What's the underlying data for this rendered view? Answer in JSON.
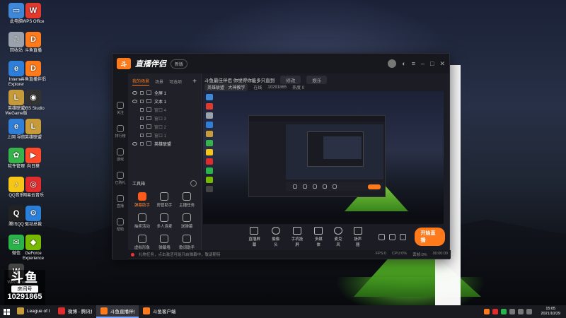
{
  "desktop": {
    "icons": [
      {
        "label": "此电脑",
        "color": "#3f87d9",
        "glyph": "▭"
      },
      {
        "label": "WPS Office",
        "color": "#e03a2f",
        "glyph": "W"
      },
      {
        "label": "回收站",
        "color": "#9aa3ad",
        "glyph": "♲"
      },
      {
        "label": "斗鱼直播",
        "color": "#ff7a1a",
        "glyph": "D"
      },
      {
        "label": "Internet Explorer",
        "color": "#2f7fd8",
        "glyph": "e"
      },
      {
        "label": "斗鱼直播伴侣",
        "color": "#ff7a1a",
        "glyph": "D"
      },
      {
        "label": "英雄联盟 WeGame版",
        "color": "#c79a3a",
        "glyph": "L"
      },
      {
        "label": "OBS Studio",
        "color": "#333333",
        "glyph": "◉"
      },
      {
        "label": "上网 导航",
        "color": "#2f7fd8",
        "glyph": "e"
      },
      {
        "label": "英雄联盟",
        "color": "#c79a3a",
        "glyph": "L"
      },
      {
        "label": "软件管理",
        "color": "#36b34a",
        "glyph": "✿"
      },
      {
        "label": "向日葵",
        "color": "#ff4a2a",
        "glyph": "▶"
      },
      {
        "label": "QQ音乐",
        "color": "#f5c518",
        "glyph": "♪"
      },
      {
        "label": "网易云音乐",
        "color": "#e02c2c",
        "glyph": "◎"
      },
      {
        "label": "腾讯QQ",
        "color": "#222222",
        "glyph": "Q"
      },
      {
        "label": "驱动总裁",
        "color": "#2a7fd8",
        "glyph": "⚙"
      },
      {
        "label": "微信",
        "color": "#2ab34a",
        "glyph": "✉"
      },
      {
        "label": "GeForce Experience",
        "color": "#76b900",
        "glyph": "◆"
      },
      {
        "label": "WeGame",
        "color": "#444444",
        "glyph": "W"
      }
    ],
    "douyu_block": {
      "logo": "斗鱼",
      "room_label": "房间号",
      "room_number": "10291865"
    }
  },
  "app": {
    "name": "直播伴侣",
    "version_pill": "新版",
    "title_controls": [
      "皮肤",
      "菜单",
      "最小化",
      "最大化",
      "关闭"
    ],
    "rail": [
      {
        "label": "关注"
      },
      {
        "label": "排行榜"
      },
      {
        "label": "游戏"
      },
      {
        "label": "已购礼"
      },
      {
        "label": "直播"
      },
      {
        "label": "帮助"
      }
    ],
    "scene_tabs": [
      "我的场景",
      "场景",
      "可选项"
    ],
    "layers": [
      {
        "label": "全屏 1",
        "dim": false
      },
      {
        "label": "文本 1",
        "dim": false
      },
      {
        "label": "窗口 4",
        "dim": true
      },
      {
        "label": "窗口 3",
        "dim": true
      },
      {
        "label": "窗口 2",
        "dim": true
      },
      {
        "label": "窗口 1",
        "dim": true
      },
      {
        "label": "英雄联盟",
        "dim": false
      }
    ],
    "toolbox_title": "工具箱",
    "tools": [
      {
        "label": "弹幕助手",
        "hot": true
      },
      {
        "label": "房管助手",
        "hot": false
      },
      {
        "label": "主播任务",
        "hot": false
      },
      {
        "label": "抽奖活动",
        "hot": false
      },
      {
        "label": "多人连麦",
        "hot": false
      },
      {
        "label": "送弹幕",
        "hot": false
      },
      {
        "label": "虚拟形象",
        "hot": false
      },
      {
        "label": "弹幕墙",
        "hot": false
      },
      {
        "label": "歌词助手",
        "hot": false
      }
    ],
    "info_bar": {
      "title": "斗鱼最佳伴侣 你觉得你能多只直到",
      "edit": "修改",
      "category": "娱乐",
      "tag": "英雄联盟 · 大神教学",
      "online_label": "在线",
      "room": "10291865",
      "hot": "热度 0"
    },
    "controls": [
      {
        "label": "直播屏幕"
      },
      {
        "label": "摄像头"
      },
      {
        "label": "手机投屏"
      },
      {
        "label": "多媒体"
      },
      {
        "label": "麦克风"
      },
      {
        "label": "扬声器"
      }
    ],
    "go_live": "开始直播",
    "status_bar": {
      "notice": "礼物任务，点击激活可能开启弹幕中，敬请期待",
      "fps": "FPS:0",
      "cpu": "CPU:0%",
      "loss": "丢帧:0%",
      "timer": "00:00:00"
    }
  },
  "taskbar": {
    "items": [
      {
        "label": "League of Legends",
        "color": "#c79a3a",
        "active": false
      },
      {
        "label": "微博 - 腾讯视频",
        "color": "#e02c2c",
        "active": false
      },
      {
        "label": "斗鱼直播伴侣",
        "color": "#ff7a1a",
        "active": true
      },
      {
        "label": "斗鱼客户端",
        "color": "#ff7a1a",
        "active": false
      }
    ],
    "time": "15:05",
    "date": "2021/10/29"
  }
}
